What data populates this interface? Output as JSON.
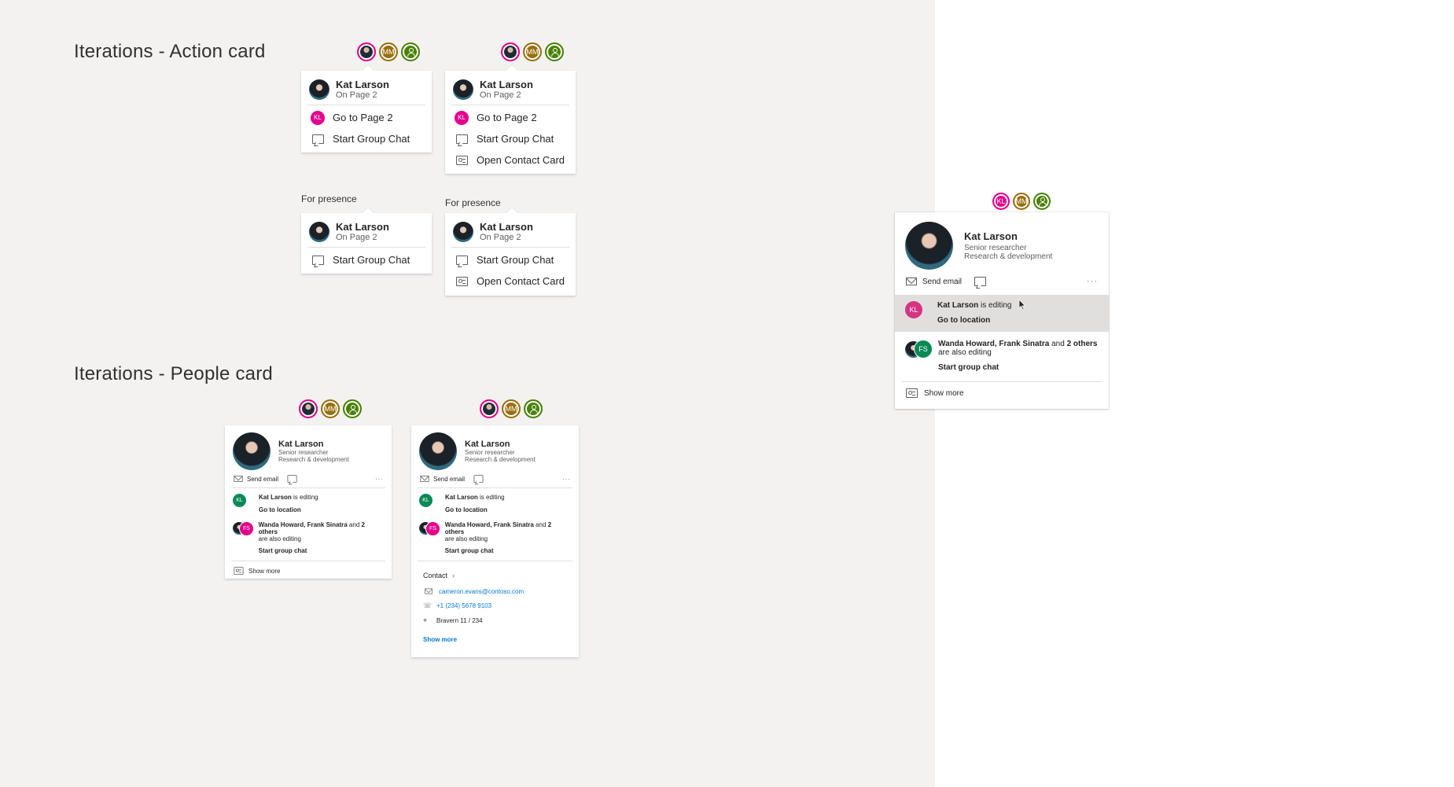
{
  "section_titles": {
    "action": "Iterations - Action card",
    "people": "Iterations - People card"
  },
  "presence_label": "For presence",
  "avatars": {
    "photo": "",
    "mm": "MM",
    "kl": "KL",
    "user_icon": "user-icon"
  },
  "person": {
    "name": "Kat Larson",
    "location": "On Page 2",
    "title": "Senior researcher",
    "department": "Research & development"
  },
  "actions": {
    "go_to_page": "Go to Page 2",
    "start_group_chat": "Start Group Chat",
    "open_contact_card": "Open Contact Card"
  },
  "people_card": {
    "send_email": "Send email",
    "more": "···",
    "kl_initials": "KL",
    "fs_initials": "FS",
    "editing_name": "Kat Larson",
    "editing_suffix": " is editing",
    "go_to_location": "Go to location",
    "others_names": "Wanda Howard, Frank Sinatra",
    "others_and": " and ",
    "others_count": "2 others",
    "others_suffix": "are also editing",
    "start_group_chat": "Start group chat",
    "show_more": "Show more",
    "contact_heading": "Contact",
    "email": "cameron.evans@contoso.com",
    "phone": "+1 (234) 5678 9103",
    "office": "Bravern 11 / 234",
    "contact_show_more": "Show more"
  },
  "colors": {
    "canvas": "#f3f2f1",
    "magenta": "#e3008c",
    "gold": "#986f0b",
    "green": "#498205",
    "teal_green": "#0b8a55",
    "link": "#0078d4"
  }
}
